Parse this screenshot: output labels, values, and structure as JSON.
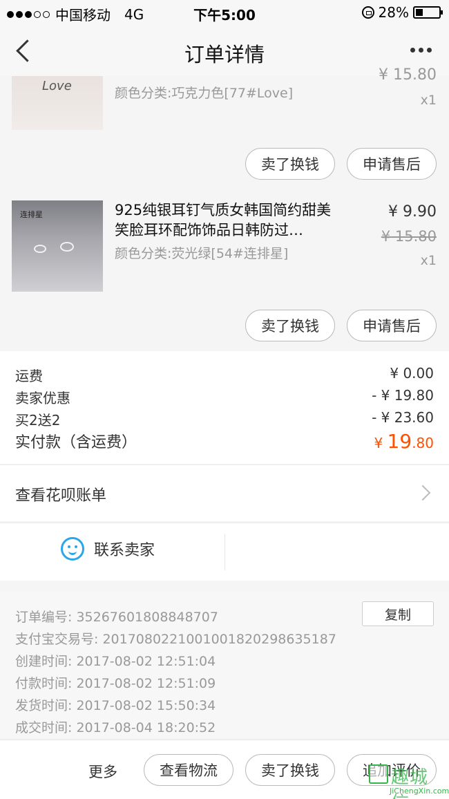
{
  "status_bar": {
    "carrier": "中国移动",
    "network": "4G",
    "time": "下午5:00",
    "battery": "28%",
    "battery_level": 0.28
  },
  "nav": {
    "title": "订单详情"
  },
  "products": [
    {
      "sku": "颜色分类:巧克力色[77#Love]",
      "price_partial": "¥ 15.80",
      "qty": "x1",
      "thumb_text": "Love",
      "actions": [
        "卖了换钱",
        "申请售后"
      ]
    },
    {
      "title": "925纯银耳钉气质女韩国简约甜美笑脸耳环配饰饰品日韩防过…",
      "sku": "颜色分类:荧光绿[54#连排星]",
      "price": "¥ 9.90",
      "original_price": "¥ 15.80",
      "qty": "x1",
      "thumb_text": "连排星",
      "actions": [
        "卖了换钱",
        "申请售后"
      ]
    }
  ],
  "fees": {
    "shipping_label": "运费",
    "shipping_value": "¥ 0.00",
    "seller_discount_label": "卖家优惠",
    "seller_discount_value": "- ¥ 19.80",
    "promo_label": "买2送2",
    "promo_value": "- ¥ 23.60",
    "total_label": "实付款（含运费）",
    "total_currency": "¥ ",
    "total_int": "19",
    "total_dec": ".80"
  },
  "huabei": {
    "label": "查看花呗账单"
  },
  "contact": {
    "label": "联系卖家"
  },
  "order_info": {
    "copy_label": "复制",
    "rows": [
      "订单编号:   35267601808848707",
      "支付宝交易号:   2017080221001001820298635187",
      "创建时间:   2017-08-02 12:51:04",
      "付款时间:   2017-08-02 12:51:09",
      "发货时间:   2017-08-02 15:50:34",
      "成交时间:   2017-08-04 18:20:52"
    ]
  },
  "action_bar": {
    "more": "更多",
    "logistics": "查看物流",
    "resell": "卖了换钱",
    "review": "追加评价"
  },
  "watermark": {
    "chars": "趣城信",
    "site": "JiChengXin.com"
  }
}
